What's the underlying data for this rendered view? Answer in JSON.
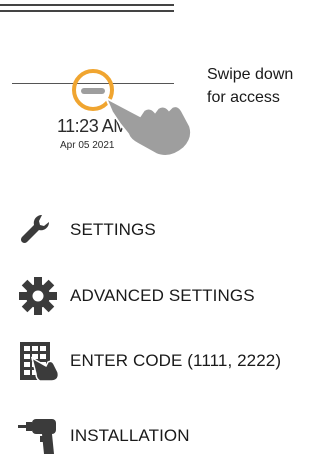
{
  "header": {
    "time": "11:23 AM",
    "date": "Apr 05 2021"
  },
  "hint": {
    "line1": "Swipe down",
    "line2": "for access"
  },
  "menu": {
    "items": [
      {
        "label": "SETTINGS",
        "icon": "wrench-icon"
      },
      {
        "label": "ADVANCED SETTINGS",
        "icon": "gear-icon"
      },
      {
        "label": "ENTER CODE (1111, 2222)",
        "icon": "keypad-hand-icon"
      },
      {
        "label": "INSTALLATION",
        "icon": "drill-icon"
      }
    ]
  },
  "colors": {
    "accent": "#f0a530",
    "icon": "#3b3b3b",
    "hand": "#9e9e9e"
  }
}
